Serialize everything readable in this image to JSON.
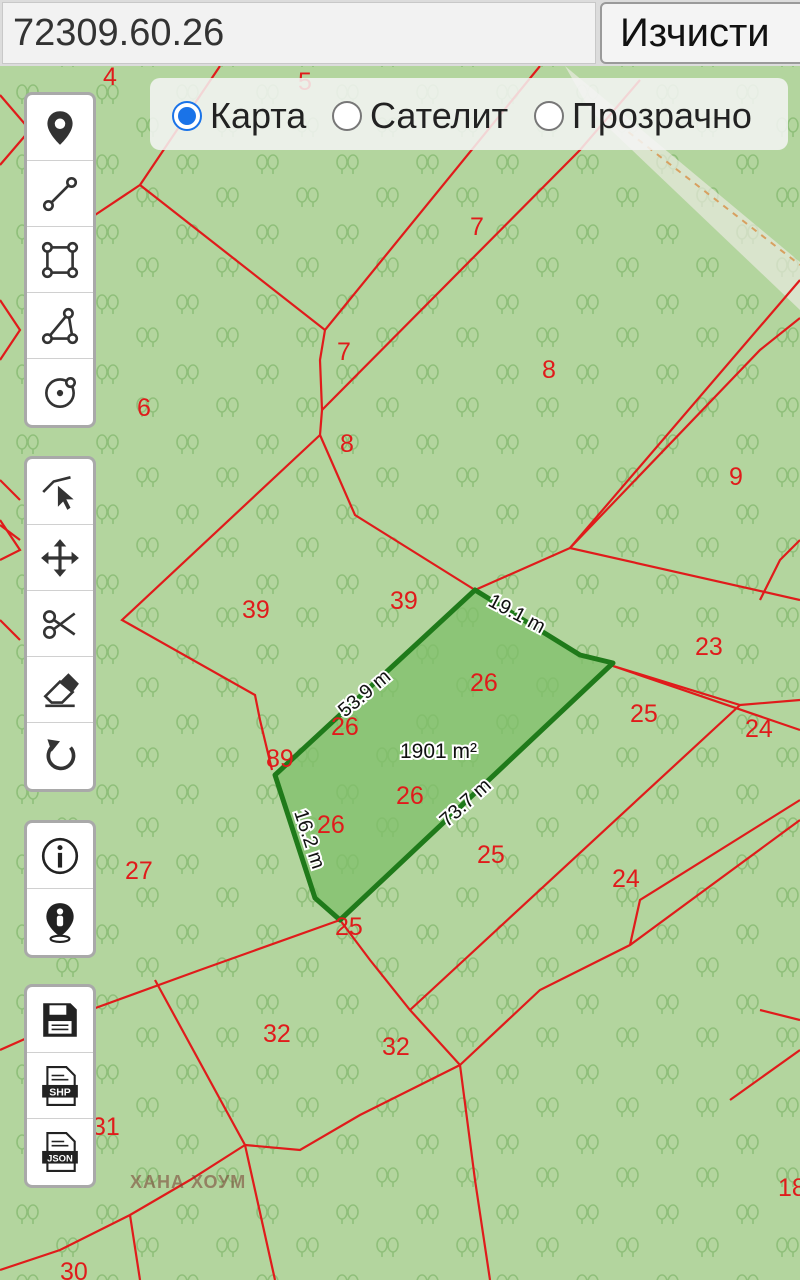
{
  "search": {
    "value": "72309.60.26"
  },
  "clear_button": {
    "label": "Изчисти"
  },
  "layers": [
    {
      "label": "Карта",
      "selected": true
    },
    {
      "label": "Сателит",
      "selected": false
    },
    {
      "label": "Прозрачно",
      "selected": false
    }
  ],
  "toolbars": {
    "draw": [
      "marker-icon",
      "polyline-icon",
      "rectangle-icon",
      "polygon-icon",
      "circle-icon"
    ],
    "edit": [
      "edit-vertices-icon",
      "drag-icon",
      "cut-icon",
      "eraser-icon",
      "rotate-icon"
    ],
    "info": [
      "info-icon",
      "locate-person-icon"
    ],
    "export": [
      "save-icon",
      "shp-file-icon",
      "json-file-icon"
    ]
  },
  "file_badges": {
    "shp": "SHP",
    "json": "JSON"
  },
  "parcel_labels": [
    "4",
    "5",
    "7",
    "7",
    "8",
    "8",
    "6",
    "9",
    "39",
    "39",
    "23",
    "26",
    "25",
    "24",
    "26",
    "89",
    "26",
    "26",
    "27",
    "25",
    "24",
    "25",
    "32",
    "32",
    "31",
    "18",
    "30"
  ],
  "measurements": {
    "area": "1901 m²",
    "edges": [
      "19.1 m",
      "53.9 m",
      "73.7 m",
      "16.2 m"
    ]
  },
  "watermark": "ХАНА ХОУМ",
  "colors": {
    "map_background": "#b3d59e",
    "parcel_border": "#e01b1b",
    "parcel_label": "#e01b1b",
    "selection_stroke": "#1f7a1a",
    "selection_fill": "#7fbf6a",
    "radio_accent": "#1a73e8"
  }
}
